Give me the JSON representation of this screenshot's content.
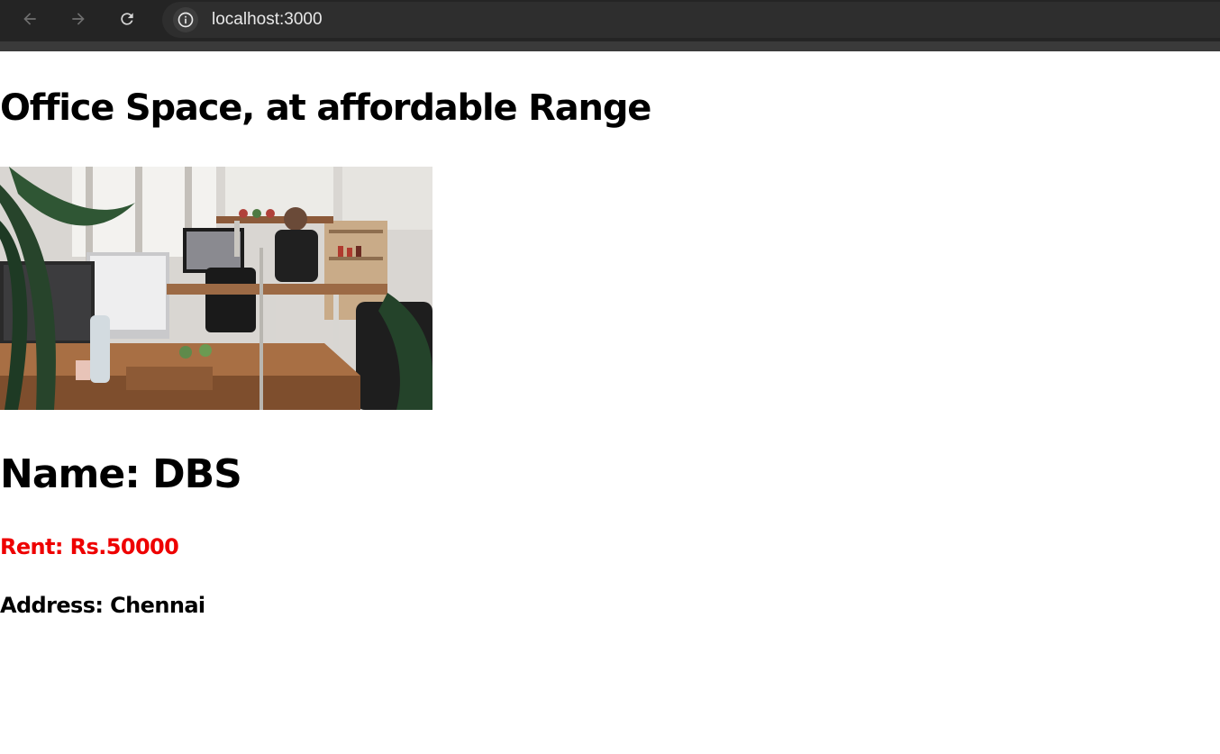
{
  "browser": {
    "url": "localhost:3000"
  },
  "page": {
    "title": "Office Space, at affordable Range",
    "office": {
      "name_line": "Name: DBS",
      "rent_line": "Rent: Rs.50000",
      "address_line": "Address: Chennai",
      "rent_color": "#ee0000"
    }
  },
  "icons": {
    "back": "arrow-left-icon",
    "forward": "arrow-right-icon",
    "reload": "reload-icon",
    "site_info": "info-icon"
  }
}
